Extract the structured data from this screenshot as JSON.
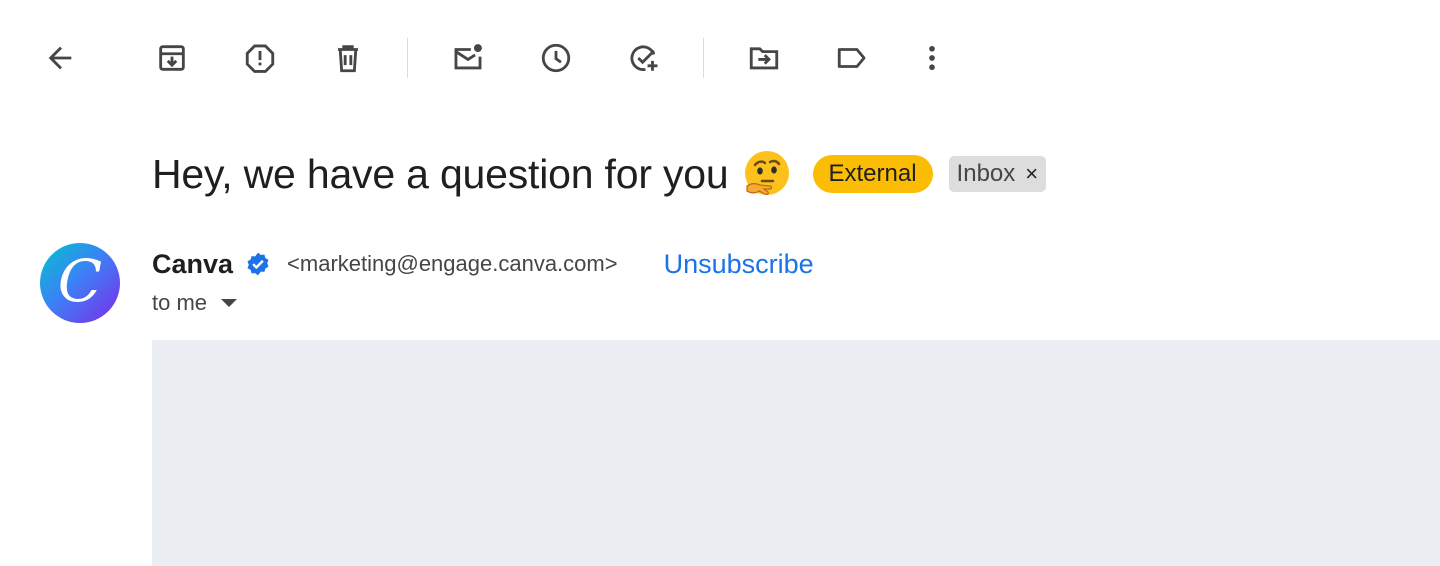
{
  "toolbar": {
    "icons": [
      "back-arrow-icon",
      "archive-icon",
      "report-spam-icon",
      "delete-icon",
      "mark-unread-icon",
      "snooze-icon",
      "add-to-tasks-icon",
      "move-to-icon",
      "label-icon",
      "more-vert-icon"
    ]
  },
  "email": {
    "subject": "Hey, we have a question for you",
    "subject_emoji": "thinking-face-emoji",
    "labels": {
      "external": "External",
      "inbox": "Inbox",
      "inbox_remove": "×"
    },
    "sender": {
      "name": "Canva",
      "email": "<marketing@engage.canva.com>",
      "avatar_letter": "C"
    },
    "unsubscribe": "Unsubscribe",
    "recipient": "to me"
  },
  "colors": {
    "external_badge": "#fbbc04",
    "link": "#1a73e8",
    "verified": "#1a73e8",
    "body_placeholder": "#eaedf1"
  }
}
